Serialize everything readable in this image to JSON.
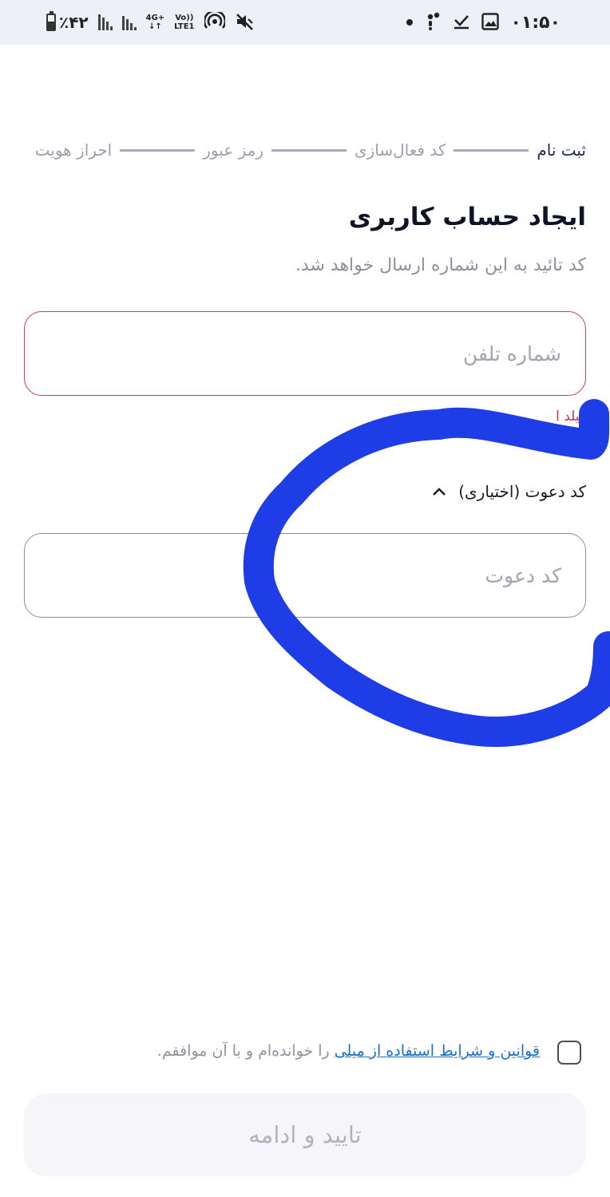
{
  "status_bar": {
    "battery": "٪۴۲",
    "network_1": "4G+",
    "network_2": "Vo))",
    "network_3": "LTE1",
    "time": "۰۱:۵۰"
  },
  "stepper": {
    "steps": [
      {
        "label": "ثبت نام",
        "active": true
      },
      {
        "label": "کد فعال‌سازی",
        "active": false
      },
      {
        "label": "رمز عبور",
        "active": false
      },
      {
        "label": "احراز هویت",
        "active": false
      }
    ]
  },
  "page": {
    "title": "ایجاد حساب کاربری",
    "subtitle": "کد تائید به این شماره ارسال خواهد شد."
  },
  "phone_input": {
    "placeholder": "شماره تلفن",
    "value": "",
    "error_partial": "فیلد ا"
  },
  "invite": {
    "toggle_label": "کد دعوت (اختیاری)",
    "placeholder": "کد دعوت",
    "value": "",
    "expanded": true
  },
  "terms": {
    "link_text": "قوانین و شرایط استفاده از میلی",
    "suffix_text": " را خوانده‌ام و با آن موافقم.",
    "checked": false
  },
  "submit": {
    "label": "تایید و ادامه"
  },
  "annotation": {
    "color": "#1f3de6"
  },
  "colors": {
    "error": "#d23b52",
    "link": "#1c6fc4",
    "accent_text": "#1d2a52"
  }
}
